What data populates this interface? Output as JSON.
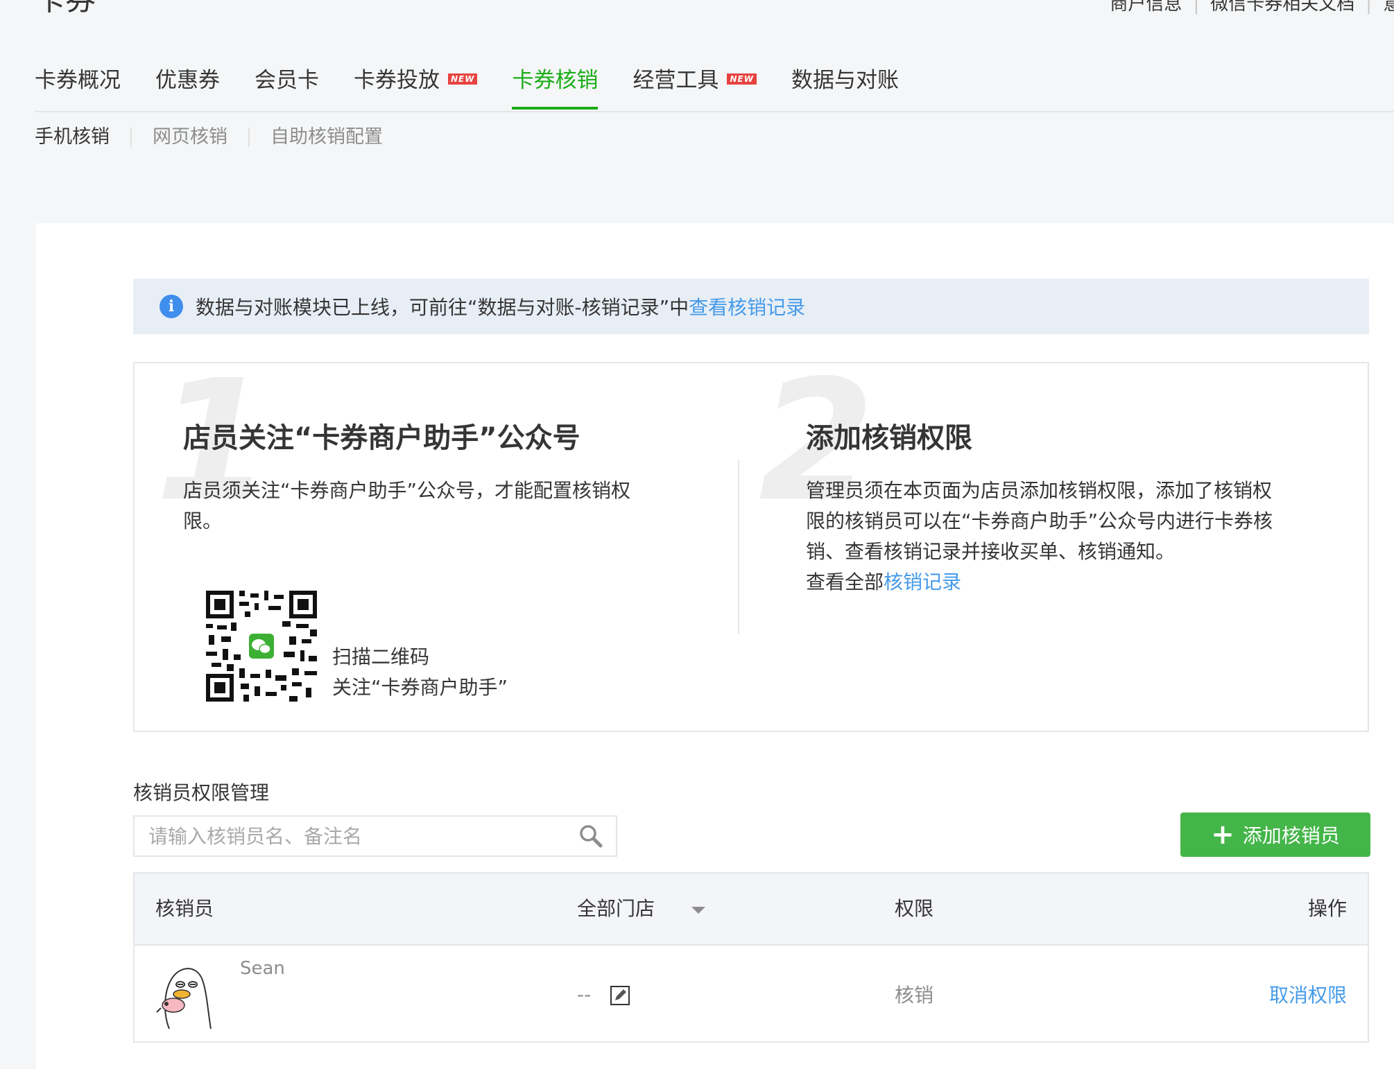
{
  "header": {
    "title": "卡券",
    "links": [
      "商户信息",
      "微信卡券相关文档",
      "意"
    ]
  },
  "main_nav": [
    {
      "label": "卡券概况",
      "new": false,
      "active": false
    },
    {
      "label": "优惠券",
      "new": false,
      "active": false
    },
    {
      "label": "会员卡",
      "new": false,
      "active": false
    },
    {
      "label": "卡券投放",
      "new": true,
      "active": false
    },
    {
      "label": "卡券核销",
      "new": false,
      "active": true
    },
    {
      "label": "经营工具",
      "new": true,
      "active": false
    },
    {
      "label": "数据与对账",
      "new": false,
      "active": false
    }
  ],
  "new_badge": "NEW",
  "sub_nav": [
    {
      "label": "手机核销",
      "current": true
    },
    {
      "label": "网页核销",
      "current": false
    },
    {
      "label": "自助核销配置",
      "current": false
    }
  ],
  "notice": {
    "text": "数据与对账模块已上线，可前往“数据与对账-核销记录”中",
    "link": "查看核销记录"
  },
  "steps": [
    {
      "number": "1",
      "title": "店员关注“卡券商户助手”公众号",
      "desc_line1": "店员须关注“卡券商户助手”公众号，才能配置核销权",
      "desc_line2": "限。",
      "qr_caption_line1": "扫描二维码",
      "qr_caption_line2": "关注“卡券商户助手”"
    },
    {
      "number": "2",
      "title": "添加核销权限",
      "desc_line1": "管理员须在本页面为店员添加核销权限，添加了核销权",
      "desc_line2": "限的核销员可以在“卡券商户助手”公众号内进行卡券核",
      "desc_line3": "销、查看核销记录并接收买单、核销通知。",
      "desc_line4_prefix": "查看全部",
      "desc_line4_link": "核销记录"
    }
  ],
  "management": {
    "title": "核销员权限管理",
    "search_placeholder": "请输入核销员名、备注名",
    "add_button": "添加核销员"
  },
  "table": {
    "headers": {
      "staff": "核销员",
      "store": "全部门店",
      "permission": "权限",
      "action": "操作"
    },
    "rows": [
      {
        "name": "Sean",
        "store": "--",
        "permission": "核销",
        "action": "取消权限"
      }
    ]
  },
  "colors": {
    "brand_green": "#1aad19",
    "button_green": "#44b549",
    "link_blue": "#459ae9",
    "notice_bg": "#e8eef6",
    "info_icon_blue": "#3f8eed"
  }
}
